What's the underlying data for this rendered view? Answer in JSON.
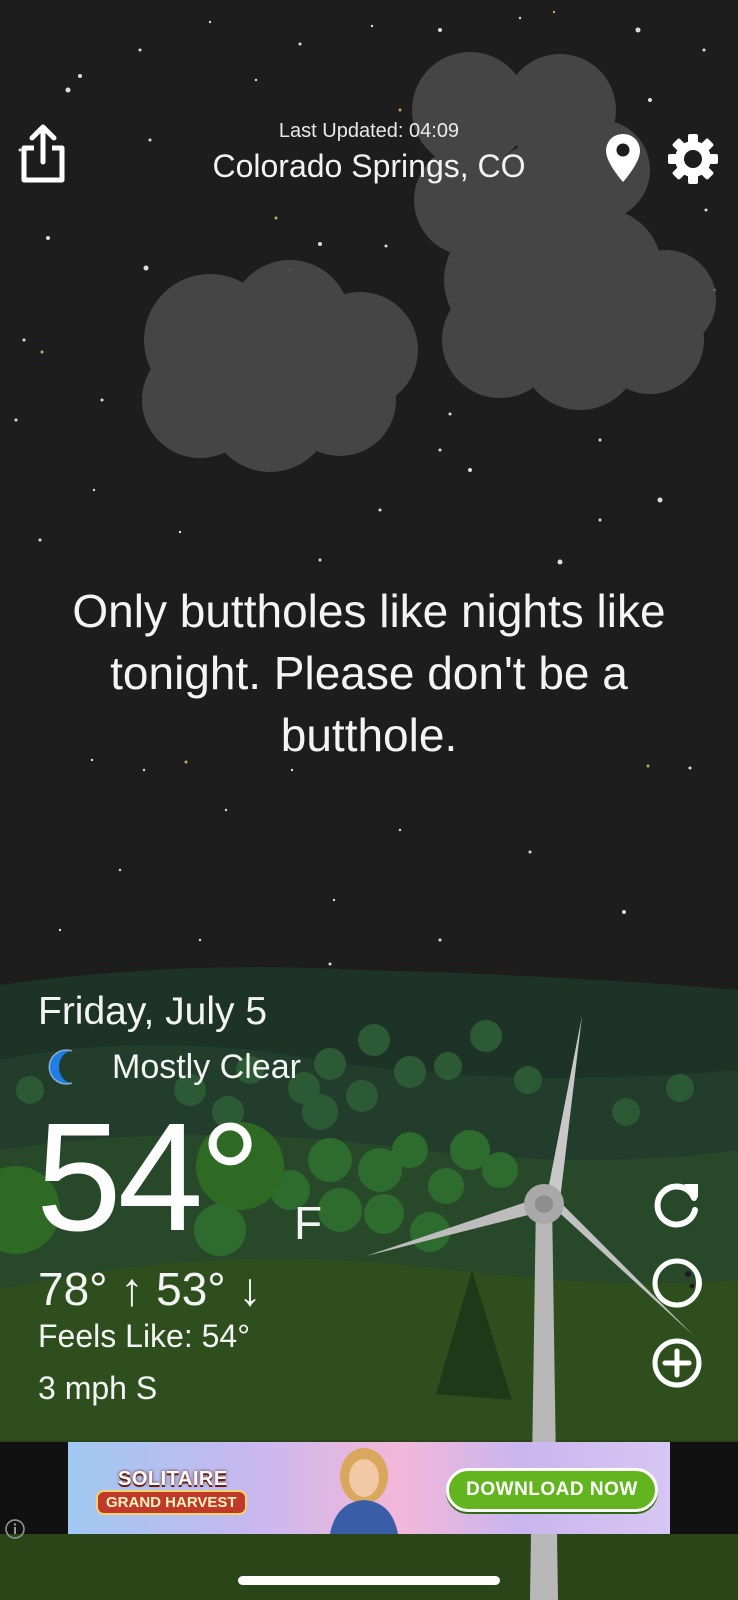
{
  "header": {
    "last_updated": "Last Updated: 04:09",
    "location": "Colorado Springs, CO",
    "share_icon": "share-icon",
    "pin_icon": "location-pin-icon",
    "gear_icon": "gear-icon"
  },
  "quote": "Only buttholes like nights like tonight. Please don't be a butthole.",
  "weather": {
    "date": "Friday, July 5",
    "condition": "Mostly Clear",
    "condition_icon": "moon-icon",
    "temperature": "54°",
    "unit": "F",
    "high_low": "78° ↑ 53° ↓",
    "feels_like": "Feels Like: 54°",
    "wind": "3 mph S"
  },
  "side_actions": {
    "refresh_icon": "refresh-icon",
    "moon_phase_icon": "moon-phase-icon",
    "add_icon": "add-icon"
  },
  "ad": {
    "brand_line1": "SOLITAIRE",
    "brand_line2": "GRAND HARVEST",
    "cta": "DOWNLOAD NOW"
  },
  "colors": {
    "sky": "#1d1d1e",
    "hills_far": "#203528",
    "hills_near": "#2e4a1f",
    "accent_blue": "#1f7de6"
  }
}
